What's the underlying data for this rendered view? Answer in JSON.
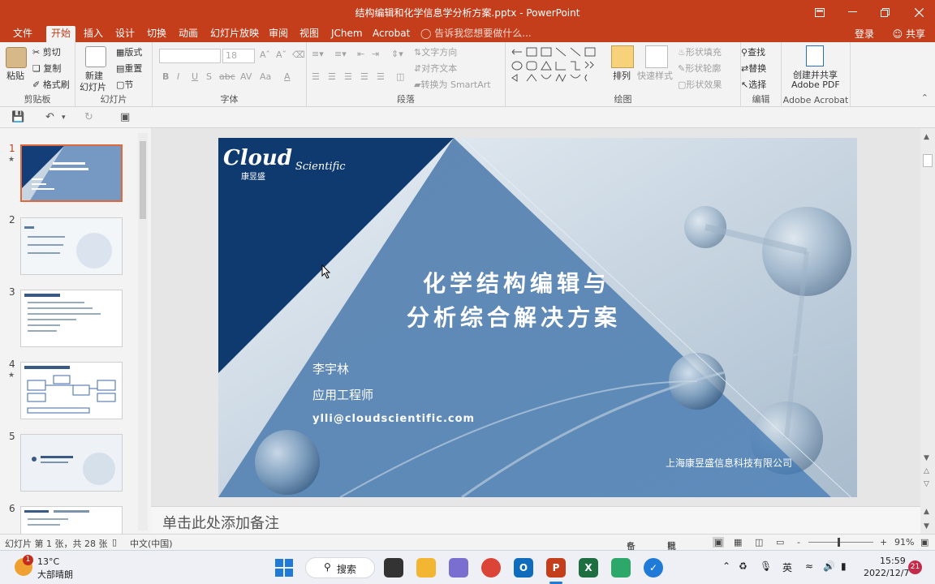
{
  "window": {
    "title": "结构编辑和化学信息学分析方案.pptx - PowerPoint"
  },
  "tabs": [
    {
      "label": "文件"
    },
    {
      "label": "开始"
    },
    {
      "label": "插入"
    },
    {
      "label": "设计"
    },
    {
      "label": "切换"
    },
    {
      "label": "动画"
    },
    {
      "label": "幻灯片放映"
    },
    {
      "label": "审阅"
    },
    {
      "label": "视图"
    },
    {
      "label": "JChem"
    },
    {
      "label": "Acrobat"
    }
  ],
  "tell_me": "告诉我您想要做什么...",
  "account": {
    "login": "登录",
    "share": "共享"
  },
  "ribbon": {
    "clipboard": {
      "paste": "粘贴",
      "cut": "剪切",
      "copy": "复制",
      "format_painter": "格式刷",
      "label": "剪贴板"
    },
    "slides": {
      "new_slide": "新建",
      "new_slide2": "幻灯片",
      "layout": "版式",
      "reset": "重置",
      "section": "节",
      "label": "幻灯片"
    },
    "font": {
      "size": "18",
      "bold": "B",
      "italic": "I",
      "underline": "U",
      "strike": "S",
      "abc": "abc",
      "spacing": "AV",
      "case": "Aa",
      "color": "A",
      "label": "字体"
    },
    "paragraph": {
      "text_dir": "文字方向",
      "align_text": "对齐文本",
      "smartart": "转换为 SmartArt",
      "label": "段落"
    },
    "drawing": {
      "arrange": "排列",
      "quick_styles": "快速样式",
      "fill": "形状填充",
      "outline": "形状轮廓",
      "effects": "形状效果",
      "label": "绘图"
    },
    "editing": {
      "find": "查找",
      "replace": "替换",
      "select": "选择",
      "label": "编辑"
    },
    "acrobat": {
      "create_share": "创建并共享",
      "adobe_pdf": "Adobe PDF",
      "label": "Adobe Acrobat"
    }
  },
  "thumbnails": [
    {
      "num": "1",
      "star": "★"
    },
    {
      "num": "2",
      "star": ""
    },
    {
      "num": "3",
      "star": ""
    },
    {
      "num": "4",
      "star": "★"
    },
    {
      "num": "5",
      "star": ""
    },
    {
      "num": "6",
      "star": ""
    }
  ],
  "slide": {
    "logo_cloud": "Cloud",
    "logo_scientific": "Scientific",
    "logo_cn": "康昱盛",
    "title_line1": "化学结构编辑与",
    "title_line2": "分析综合解决方案",
    "presenter": "李宇林",
    "role": "应用工程师",
    "email": "ylli@cloudscientific.com",
    "company": "上海康昱盛信息科技有限公司"
  },
  "notes_placeholder": "单击此处添加备注",
  "status": {
    "slide_info": "幻灯片 第 1 张，共 28 张",
    "language": "中文(中国)",
    "notes": "备注",
    "comments": "批注",
    "zoom": "91%",
    "zoom_plus": "+",
    "zoom_minus": "-"
  },
  "taskbar": {
    "weather_temp": "13°C",
    "weather_desc": "大部晴朗",
    "weather_badge": "1",
    "search": "搜索",
    "ime": "英",
    "time": "15:59",
    "date": "2022/12/7",
    "notif": "21"
  }
}
